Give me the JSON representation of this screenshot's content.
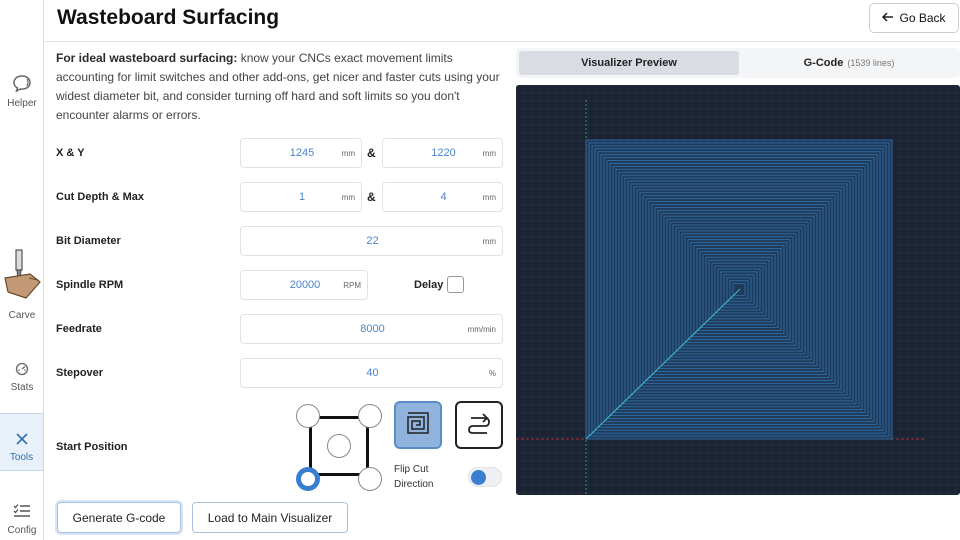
{
  "sidebar": {
    "items": [
      {
        "label": "Helper",
        "icon": "helper-icon"
      },
      {
        "label": "Carve",
        "icon": "carve-icon"
      },
      {
        "label": "Stats",
        "icon": "stats-icon"
      },
      {
        "label": "Tools",
        "icon": "tools-icon"
      },
      {
        "label": "Config",
        "icon": "config-icon"
      }
    ]
  },
  "header": {
    "title": "Wasteboard Surfacing",
    "back_label": "Go Back"
  },
  "intro": {
    "bold": "For ideal wasteboard surfacing:",
    "text": " know your CNCs exact movement limits accounting for limit switches and other add-ons, get nicer and faster cuts using your widest diameter bit, and consider turning off hard and soft limits so you don't encounter alarms or errors."
  },
  "form": {
    "xy": {
      "label": "X & Y",
      "x": "1245",
      "y": "1220",
      "unit": "mm",
      "sep": "&"
    },
    "cut_depth": {
      "label": "Cut Depth & Max",
      "depth": "1",
      "max": "4",
      "unit": "mm",
      "sep": "&"
    },
    "bit": {
      "label": "Bit Diameter",
      "value": "22",
      "unit": "mm"
    },
    "spindle": {
      "label": "Spindle RPM",
      "value": "20000",
      "unit": "RPM"
    },
    "delay": {
      "label": "Delay",
      "checked": false
    },
    "feedrate": {
      "label": "Feedrate",
      "value": "8000",
      "unit": "mm/min"
    },
    "stepover": {
      "label": "Stepover",
      "value": "40",
      "unit": "%"
    },
    "start_position": {
      "label": "Start Position",
      "selected": "bottom-left"
    },
    "cut_mode": {
      "selected": "spiral"
    },
    "flip": {
      "label": "Flip Cut Direction",
      "on": false
    }
  },
  "actions": {
    "generate": "Generate G-code",
    "load": "Load to Main Visualizer"
  },
  "preview": {
    "tab_visualizer": "Visualizer Preview",
    "tab_gcode": "G-Code",
    "gcode_lines": "(1539 lines)",
    "colors": {
      "background": "#1b2333",
      "toolpath": "#2f6ea8",
      "x_axis": "#b23030",
      "y_axis": "#2f9a78",
      "diagonal": "#3fb7c9"
    }
  }
}
